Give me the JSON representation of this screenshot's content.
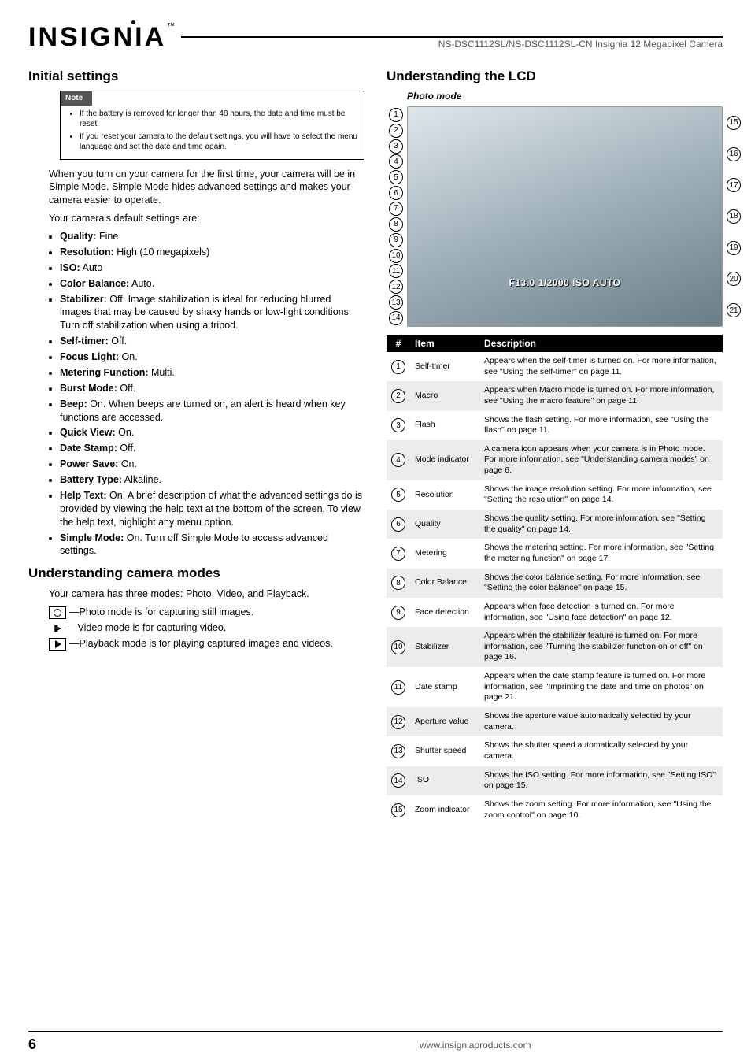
{
  "header": {
    "product": "NS-DSC1112SL/NS-DSC1112SL-CN Insignia 12 Megapixel Camera"
  },
  "brand": {
    "text": "INSIGNIA",
    "mark": "™"
  },
  "left": {
    "h_initial": "Initial settings",
    "note_label": "Note",
    "note_items": [
      "If the battery is removed for longer than 48 hours, the date and time must be reset.",
      "If you reset your camera to the default settings, you will have to select the menu language and set the date and time again."
    ],
    "intro": "When you turn on your camera for the first time, your camera will be in Simple Mode. Simple Mode hides advanced settings and makes your camera easier to operate.",
    "defaults_lead": "Your camera's default settings are:",
    "settings": [
      {
        "k": "Quality:",
        "v": " Fine"
      },
      {
        "k": "Resolution:",
        "v": " High (10 megapixels)"
      },
      {
        "k": "ISO:",
        "v": " Auto"
      },
      {
        "k": "Color Balance:",
        "v": " Auto."
      },
      {
        "k": "Stabilizer:",
        "v": " Off. Image stabilization is ideal for reducing blurred images that may be caused by shaky hands or low-light conditions. Turn off stabilization when using a tripod."
      },
      {
        "k": "Self-timer:",
        "v": " Off."
      },
      {
        "k": "Focus Light:",
        "v": " On."
      },
      {
        "k": "Metering Function:",
        "v": " Multi."
      },
      {
        "k": "Burst Mode:",
        "v": " Off."
      },
      {
        "k": "Beep:",
        "v": " On. When beeps are turned on, an alert is heard when key functions are accessed."
      },
      {
        "k": "Quick View:",
        "v": " On."
      },
      {
        "k": "Date Stamp:",
        "v": " Off."
      },
      {
        "k": "Power Save:",
        "v": " On."
      },
      {
        "k": "Battery Type:",
        "v": " Alkaline."
      },
      {
        "k": "Help Text:",
        "v": " On. A brief description of what the advanced settings do is provided by viewing the help text at the bottom of the screen. To view the help text, highlight any menu option."
      },
      {
        "k": "Simple Mode:",
        "v": " On. Turn off Simple Mode to access advanced settings."
      }
    ],
    "h_modes": "Understanding camera modes",
    "modes_lead": "Your camera has three modes: Photo, Video, and Playback.",
    "modes": [
      "—Photo mode is for capturing still images.",
      "—Video mode is for capturing video.",
      "—Playback mode is for playing captured images and videos."
    ]
  },
  "right": {
    "h_lcd": "Understanding the LCD",
    "subhead": "Photo mode",
    "overlay": "F13.0  1/2000  ISO AUTO",
    "table_headers": {
      "num": "#",
      "item": "Item",
      "desc": "Description"
    },
    "rows": [
      {
        "n": "1",
        "item": "Self-timer",
        "desc": "Appears when the self-timer is turned on. For more information, see \"Using the self-timer\" on page 11."
      },
      {
        "n": "2",
        "item": "Macro",
        "desc": "Appears when Macro mode is turned on. For more information, see \"Using the macro feature\" on page 11."
      },
      {
        "n": "3",
        "item": "Flash",
        "desc": "Shows the flash setting. For more information, see \"Using the flash\" on page 11."
      },
      {
        "n": "4",
        "item": "Mode indicator",
        "desc": "A camera icon appears when your camera is in Photo mode. For more information, see \"Understanding camera modes\" on page 6."
      },
      {
        "n": "5",
        "item": "Resolution",
        "desc": "Shows the image resolution setting. For more information, see \"Setting the resolution\" on page 14."
      },
      {
        "n": "6",
        "item": "Quality",
        "desc": "Shows the quality setting. For more information, see \"Setting the quality\" on page 14."
      },
      {
        "n": "7",
        "item": "Metering",
        "desc": "Shows the metering setting. For more information, see \"Setting the metering function\" on page 17."
      },
      {
        "n": "8",
        "item": "Color Balance",
        "desc": "Shows the color balance setting. For more information, see \"Setting the color balance\" on page 15."
      },
      {
        "n": "9",
        "item": "Face detection",
        "desc": "Appears when face detection is turned on. For more information, see \"Using face detection\" on page 12."
      },
      {
        "n": "10",
        "item": "Stabilizer",
        "desc": "Appears when the stabilizer feature is turned on. For more information, see \"Turning the stabilizer function on or off\" on page 16."
      },
      {
        "n": "11",
        "item": "Date stamp",
        "desc": "Appears when the date stamp feature is turned on. For more information, see \"Imprinting the date and time on photos\" on page 21."
      },
      {
        "n": "12",
        "item": "Aperture value",
        "desc": "Shows the aperture value automatically selected by your camera."
      },
      {
        "n": "13",
        "item": "Shutter speed",
        "desc": "Shows the shutter speed automatically selected by your camera."
      },
      {
        "n": "14",
        "item": "ISO",
        "desc": "Shows the ISO setting. For more information, see \"Setting ISO\" on page 15."
      },
      {
        "n": "15",
        "item": "Zoom indicator",
        "desc": "Shows the zoom setting. For more information, see \"Using the zoom control\" on page 10."
      }
    ],
    "diagram_left_callouts": [
      "1",
      "2",
      "3",
      "4",
      "5",
      "6",
      "7",
      "8",
      "9",
      "10",
      "11",
      "12",
      "13",
      "14"
    ],
    "diagram_right_callouts": [
      "15",
      "16",
      "17",
      "18",
      "19",
      "20",
      "21"
    ]
  },
  "footer": {
    "page": "6",
    "url": "www.insigniaproducts.com"
  }
}
